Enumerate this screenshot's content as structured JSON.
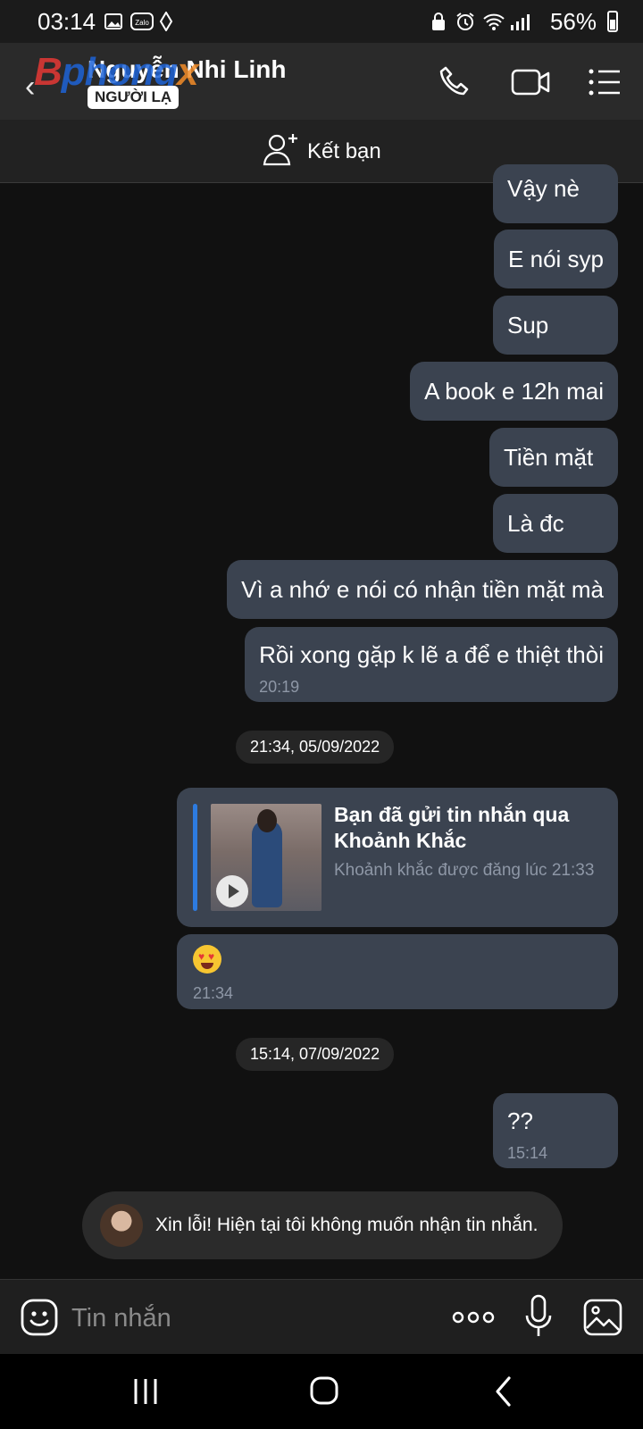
{
  "status_bar": {
    "time": "03:14",
    "battery": "56%",
    "icons": [
      "image-icon",
      "zalo-icon",
      "signal-app-icon",
      "lock-icon",
      "alarm-icon",
      "wifi-icon",
      "cell-signal-icon",
      "battery-icon"
    ]
  },
  "header": {
    "contact_name": "Nguyễn Nhi Linh",
    "badge": "NGƯỜI LẠ",
    "watermark": [
      "B",
      "phong",
      "x"
    ]
  },
  "add_friend": {
    "label": "Kết bạn"
  },
  "messages": [
    {
      "text": "Vậy nè"
    },
    {
      "text": "E nói syp"
    },
    {
      "text": "Sup"
    },
    {
      "text": "A book e 12h mai"
    },
    {
      "text": "Tiền mặt"
    },
    {
      "text": "Là đc"
    },
    {
      "text": "Vì a nhớ e nói có nhận tiền mặt mà"
    },
    {
      "text": "Rồi xong gặp k lẽ a để e thiệt thòi",
      "time": "20:19"
    }
  ],
  "date_chips": [
    "21:34, 05/09/2022",
    "15:14, 07/09/2022"
  ],
  "moment": {
    "title": "Bạn đã gửi tin nhắn qua Khoảnh Khắc",
    "subtitle": "Khoảnh khắc được đăng lúc 21:33"
  },
  "emoji_message": {
    "emoji": "😍",
    "time": "21:34"
  },
  "last_message": {
    "text": "??",
    "time": "15:14"
  },
  "block_notice": {
    "text": "Xin lỗi! Hiện tại tôi không muốn nhận tin nhắn."
  },
  "input": {
    "placeholder": "Tin nhắn"
  }
}
